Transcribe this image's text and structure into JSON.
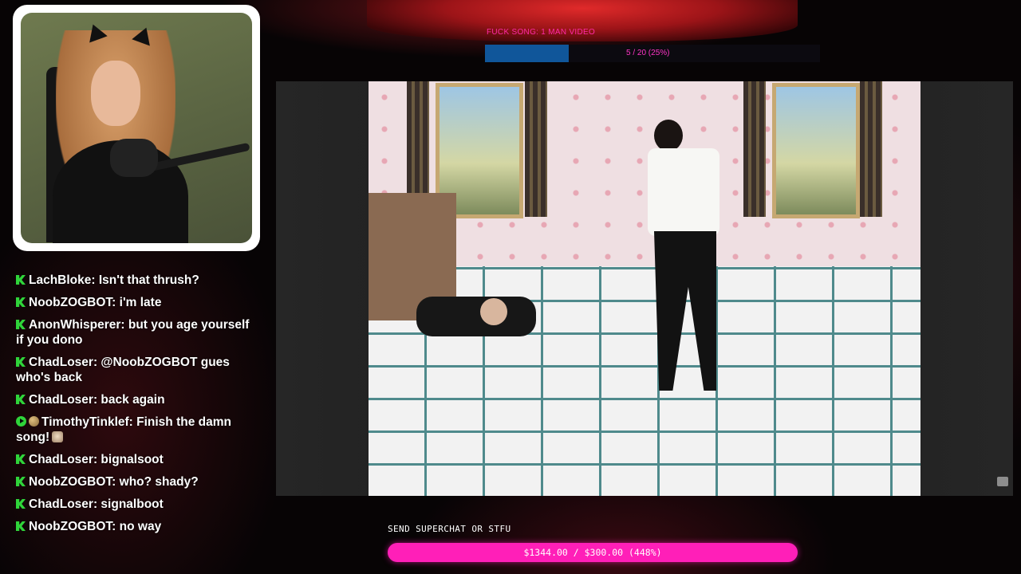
{
  "header": {
    "title": "FUCK SONG: 1 MAN VIDEO",
    "progress_text": "5 / 20 (25%)",
    "progress_fraction": 0.25,
    "progress_color": "#10569a"
  },
  "webcam": {
    "frame_color": "#ffffff"
  },
  "chat": {
    "messages": [
      {
        "badges": [
          "kick-icon"
        ],
        "user": "LachBloke:",
        "text": " Isn't that thrush?"
      },
      {
        "badges": [
          "kick-icon"
        ],
        "user": "NoobZOGBOT:",
        "text": " i'm late"
      },
      {
        "badges": [
          "kick-icon"
        ],
        "user": "AnonWhisperer:",
        "text": " but you age yourself if you dono"
      },
      {
        "badges": [
          "kick-icon"
        ],
        "user": "ChadLoser:",
        "text": " @NoobZOGBOT gues who's back"
      },
      {
        "badges": [
          "kick-icon"
        ],
        "user": "ChadLoser:",
        "text": " back again"
      },
      {
        "badges": [
          "play-icon",
          "ball-icon"
        ],
        "user": "TimothyTinklef:",
        "text": " Finish the damn song!",
        "emote": "face-emote"
      },
      {
        "badges": [
          "kick-icon"
        ],
        "user": "ChadLoser:",
        "text": " bignalsoot"
      },
      {
        "badges": [
          "kick-icon"
        ],
        "user": "NoobZOGBOT:",
        "text": " who? shady?"
      },
      {
        "badges": [
          "kick-icon"
        ],
        "user": "ChadLoser:",
        "text": " signalboot"
      },
      {
        "badges": [
          "kick-icon"
        ],
        "user": "NoobZOGBOT:",
        "text": " no way"
      }
    ],
    "badge_color": "#2fd43a"
  },
  "video": {
    "corner_icon": "chat-bubble-icon"
  },
  "superchat": {
    "label": "SEND SUPERCHAT OR STFU",
    "progress_text": "$1344.00 / $300.00 (448%)",
    "progress_fraction": 4.48,
    "bar_color": "#ff1fb8"
  }
}
